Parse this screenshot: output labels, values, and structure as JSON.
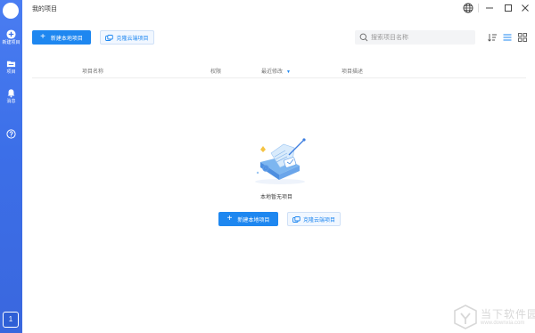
{
  "app": {
    "title": "我的项目"
  },
  "sidebar": {
    "items": [
      {
        "label": "新建项目",
        "icon": "plus-circle-icon"
      },
      {
        "label": "项目",
        "icon": "folder-icon"
      },
      {
        "label": "消息",
        "icon": "bell-icon"
      },
      {
        "label": "",
        "icon": "help-icon"
      }
    ],
    "counter": "1"
  },
  "toolbar": {
    "new_local_label": "新建本地项目",
    "clone_cloud_label": "克隆云端项目",
    "search_placeholder": "搜索项目名称"
  },
  "table": {
    "columns": [
      "项目名称",
      "权限",
      "最近修改",
      "项目描述"
    ],
    "sorted_column": "最近修改"
  },
  "empty_state": {
    "message": "本地暂无项目",
    "new_local_label": "新建本地项目",
    "clone_cloud_label": "克隆云端项目"
  },
  "watermark": {
    "cn": "当下软件园",
    "en": "www.downxia.com"
  },
  "colors": {
    "sidebar": "#3c6fe8",
    "primary": "#1e87f0",
    "outline_bg": "#f1f7ff"
  }
}
